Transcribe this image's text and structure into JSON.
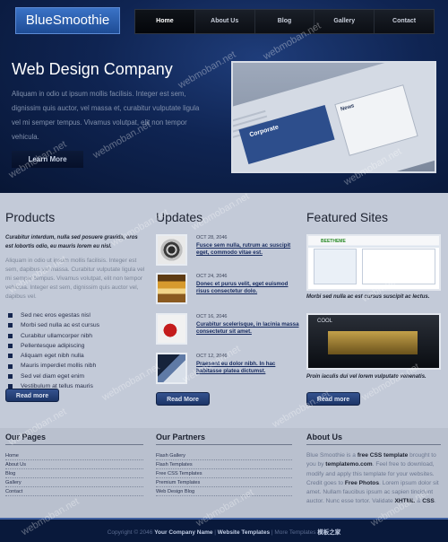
{
  "header": {
    "logo": "BlueSmoothie",
    "nav": [
      "Home",
      "About Us",
      "Blog",
      "Gallery",
      "Contact"
    ],
    "hero_title": "Web Design Company",
    "hero_text": "Aliquam in odio ut ipsum mollis facilisis. Integer est sem, dignissim quis auctor, vel massa et, curabitur vulputate ligula vel mi semper tempus. Vivamus volutpat, elit non tempor vehicula.",
    "learn_more": "Learn More",
    "hero_shot": {
      "band_title": "Corporate",
      "card_title": "News"
    }
  },
  "products": {
    "title": "Products",
    "intro": "Curabitur interdum, nulla sed posuere gravida, eros est lobortis odio, eu mauris lorem eu nisl.",
    "body": "Aliquam in odio ut ipsum mollis facilisis. Integer est sem, dapibus vel massa. Curabitur vulputate ligula vel mi semper tempus. Vivamus volutpat, elit non tempor vehicula. Integer est sem, dignissim quis auctor vel, dapibus vel.",
    "bullets": [
      "Sed nec eros egestas nisl",
      "Morbi sed nulla ac est cursus",
      "Curabitur ullamcorper nibh",
      "Pellentesque adipiscing",
      "Aliquam eget nibh nulla",
      "Mauris imperdiet mollis nibh",
      "Sed vel diam eget enim",
      "Vestibulum at tellus mauris"
    ],
    "read_more": "Read more"
  },
  "updates": {
    "title": "Updates",
    "items": [
      {
        "date": "OCT 28, 2046",
        "text": "Fusce sem nulla, rutrum ac suscipit eget, commodo vitae est."
      },
      {
        "date": "OCT 24, 2046",
        "text": "Donec et purus velit, eget euismod risus consectetur dolo."
      },
      {
        "date": "OCT 16, 2046",
        "text": "Curabitur scelerisque, in lacinia massa consectetur sit amet."
      },
      {
        "date": "OCT 12, 2046",
        "text": "Praesent eu dolor nibh. In hac habitasse platea dictumst."
      }
    ],
    "read_more": "Read More"
  },
  "featured": {
    "title": "Featured Sites",
    "sites": [
      {
        "tag": "BEETHEME",
        "caption": "Morbi sed nulla ac est cursus suscipit ac lectus."
      },
      {
        "tag": "COOL",
        "caption": "Proin iaculis dui vel lorem vulputate venenatis."
      }
    ],
    "read_more": "Read more"
  },
  "footer": {
    "pages_title": "Our Pages",
    "pages": [
      "Home",
      "About Us",
      "Blog",
      "Gallery",
      "Contact"
    ],
    "partners_title": "Our Partners",
    "partners": [
      "Flash Gallery",
      "Flash Templates",
      "Free CSS Templates",
      "Premium Templates",
      "Web Design Blog"
    ],
    "about_title": "About Us",
    "about_text_1": "Blue Smoothie is a ",
    "about_bold_1": "free CSS template",
    "about_text_2": " brought to you by ",
    "about_bold_2": "templatemo.com",
    "about_text_3": ". Feel free to download, modify and apply this template for your websites. Credit goes to ",
    "about_bold_3": "Free Photos",
    "about_text_4": ". Lorem ipsum dolor sit amet. Nullam faucibus ipsum ac sapien tincidunt auctor. Nunc esse tortor. Validate ",
    "about_bold_4": "XHTML",
    "about_text_5": " & ",
    "about_bold_5": "CSS",
    "about_text_6": "."
  },
  "copyright": {
    "prefix": "Copyright © 2046 ",
    "company": "Your Company Name",
    "sep1": " | ",
    "templates": "Website Templates",
    "sep2": " | More Templates ",
    "cn": "模板之家"
  },
  "watermark": "webmoban.net"
}
